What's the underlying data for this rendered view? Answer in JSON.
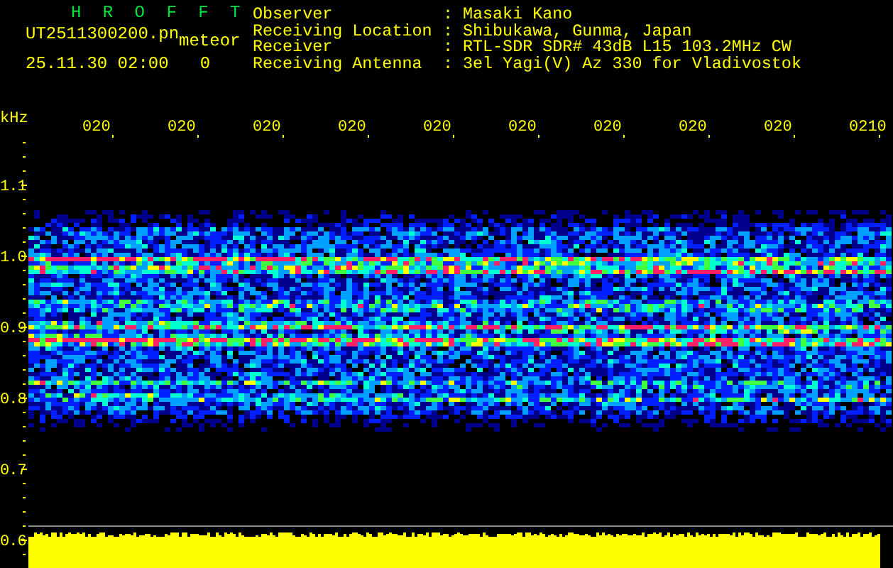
{
  "header": {
    "title": "H R O F F T",
    "filename": "UT2511300200.pn",
    "mode": "meteor",
    "timestamp": "25.11.30 02:00",
    "counter": "0"
  },
  "station_info": [
    {
      "label": "Observer",
      "separator": ":",
      "value": "Masaki Kano"
    },
    {
      "label": "Receiving Location",
      "separator": ":",
      "value": "Shibukawa, Gunma, Japan"
    },
    {
      "label": "Receiver",
      "separator": ":",
      "value": "RTL-SDR SDR# 43dB L15 103.2MHz CW"
    },
    {
      "label": "Receiving Antenna",
      "separator": ":",
      "value": "3el Yagi(V) Az 330 for Vladivostok"
    }
  ],
  "spectrogram": {
    "unit": "kHz",
    "frequency_labels": [
      "1.1",
      "1.0",
      "0.9",
      "0.8",
      "0.7",
      "0.6"
    ],
    "time_labels": [
      "020",
      "020",
      "020",
      "020",
      "020",
      "020",
      "020",
      "020",
      "020",
      "0210"
    ]
  }
}
